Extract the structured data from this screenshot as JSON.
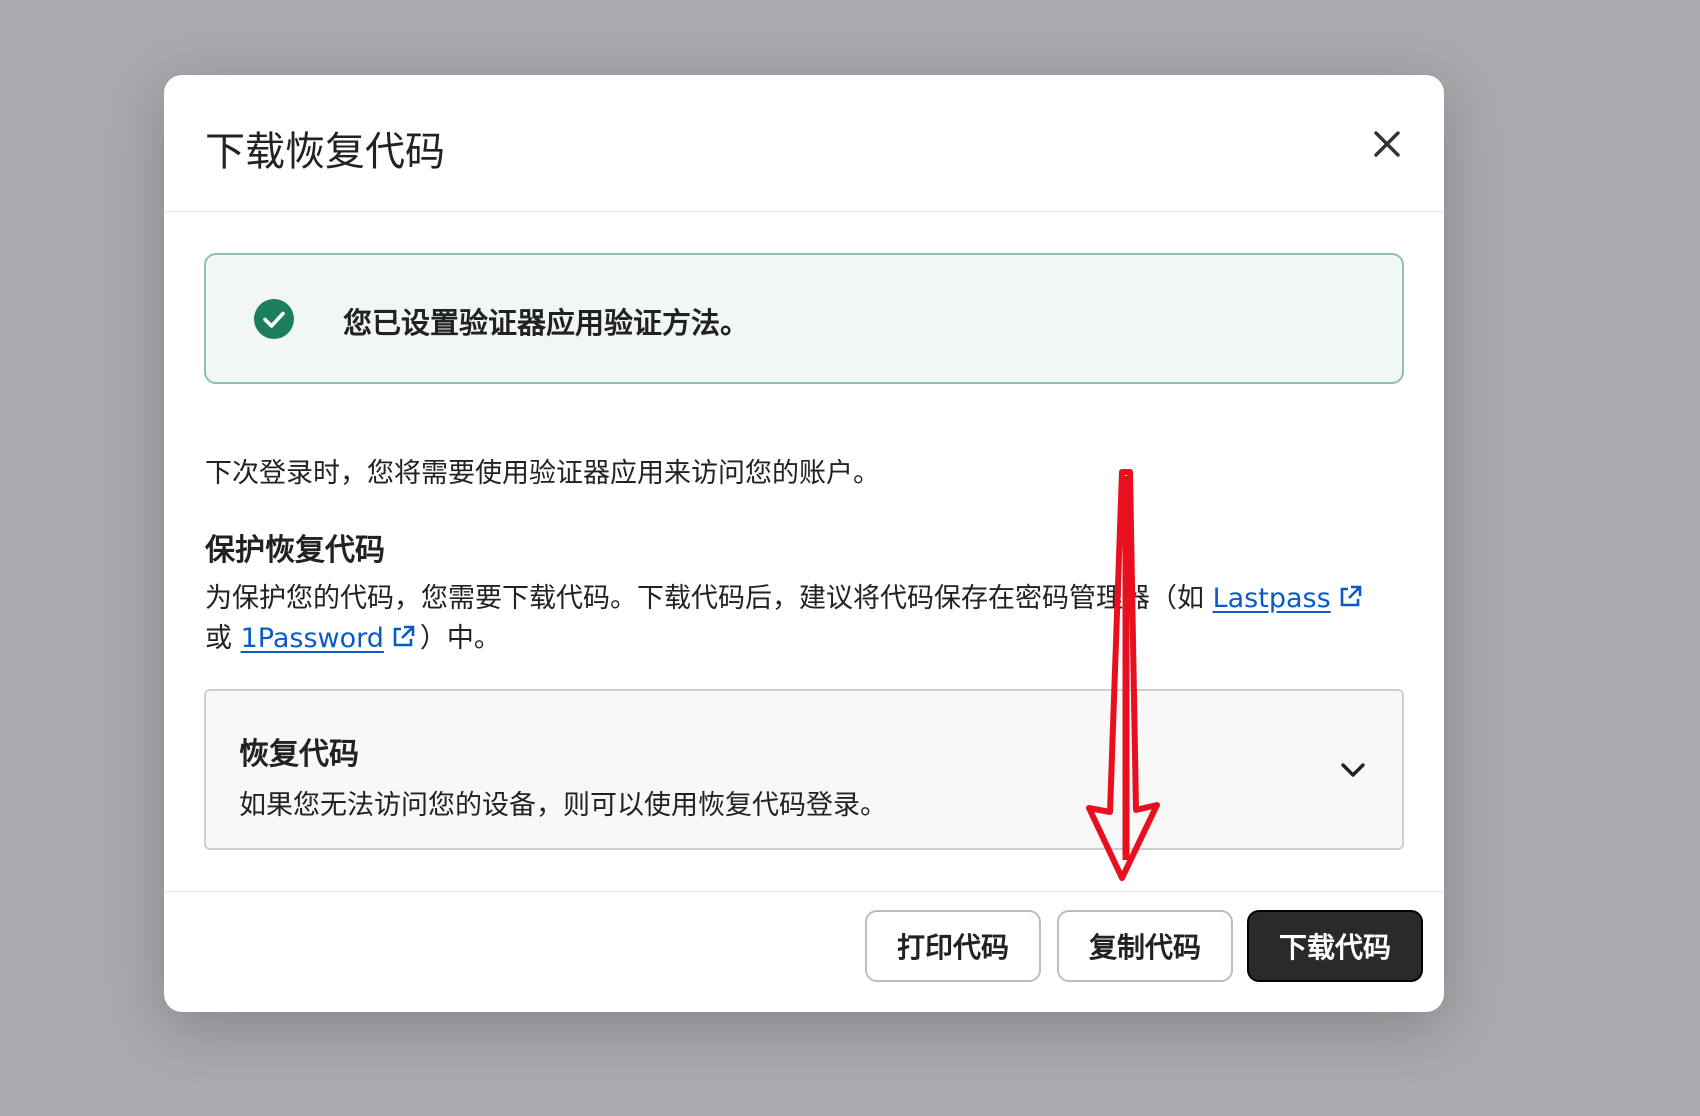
{
  "modal": {
    "title": "下载恢复代码",
    "close_icon": "close-icon"
  },
  "alert": {
    "icon": "check-circle-icon",
    "icon_color": "#1a7f5a",
    "text": "您已设置验证器应用验证方法。"
  },
  "intro": "下次登录时，您将需要使用验证器应用来访问您的账户。",
  "protect": {
    "title": "保护恢复代码",
    "desc_part1": "为保护您的代码，您需要下载代码。下载代码后，建议将代码保存在密码管理器（如 ",
    "link1": "Lastpass",
    "desc_part2": "或 ",
    "link2": "1Password",
    "desc_part3": "）中。",
    "link_color": "#0a5bc6"
  },
  "codes": {
    "title": "恢复代码",
    "desc": "如果您无法访问您的设备，则可以使用恢复代码登录。",
    "chevron": "chevron-down-icon"
  },
  "footer": {
    "print_label": "打印代码",
    "copy_label": "复制代码",
    "download_label": "下载代码"
  },
  "annotation": {
    "color": "#e8101e"
  }
}
